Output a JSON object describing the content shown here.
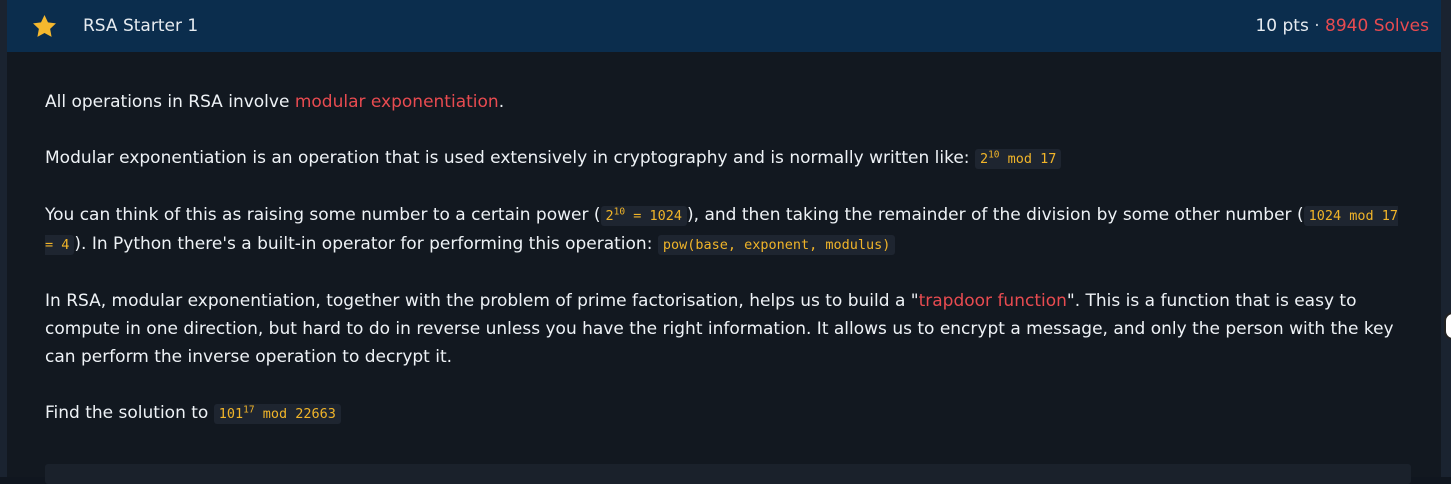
{
  "challenge": {
    "title": "RSA Starter 1",
    "points": "10 pts",
    "separator": "·",
    "solves": "8940 Solves",
    "icon": "star-icon"
  },
  "description": {
    "p1": {
      "text": "All operations in RSA involve ",
      "link": "modular exponentiation",
      "end": "."
    },
    "p2": {
      "text": "Modular exponentiation is an operation that is used extensively in cryptography and is normally written like: ",
      "code_base": "2",
      "code_exp": "10",
      "code_rest": " mod 17"
    },
    "p3": {
      "text_a": "You can think of this as raising some number to a certain power (",
      "code1_base": "2",
      "code1_exp": "10",
      "code1_rest": " = 1024",
      "text_b": "), and then taking the remainder of the division by some other number (",
      "code2": "1024 mod 17 = 4",
      "text_c": "). In Python there's a built-in operator for performing this operation: ",
      "code3": "pow(base, exponent, modulus)"
    },
    "p4": {
      "text_a": "In RSA, modular exponentiation, together with the problem of prime factorisation, helps us to build a \"",
      "link": "trapdoor function",
      "text_b": "\". This is a function that is easy to compute in one direction, but hard to do in reverse unless you have the right information. It allows us to encrypt a message, and only the person with the key can perform the inverse operation to decrypt it."
    },
    "p5": {
      "text": "Find the solution to ",
      "code_base": "101",
      "code_exp": "17",
      "code_rest": " mod 22663"
    }
  },
  "colors": {
    "header_bg": "#0b2d4d",
    "accent_red": "#e84b50",
    "code_yellow": "#f0b429",
    "star": "#f5b82e"
  }
}
